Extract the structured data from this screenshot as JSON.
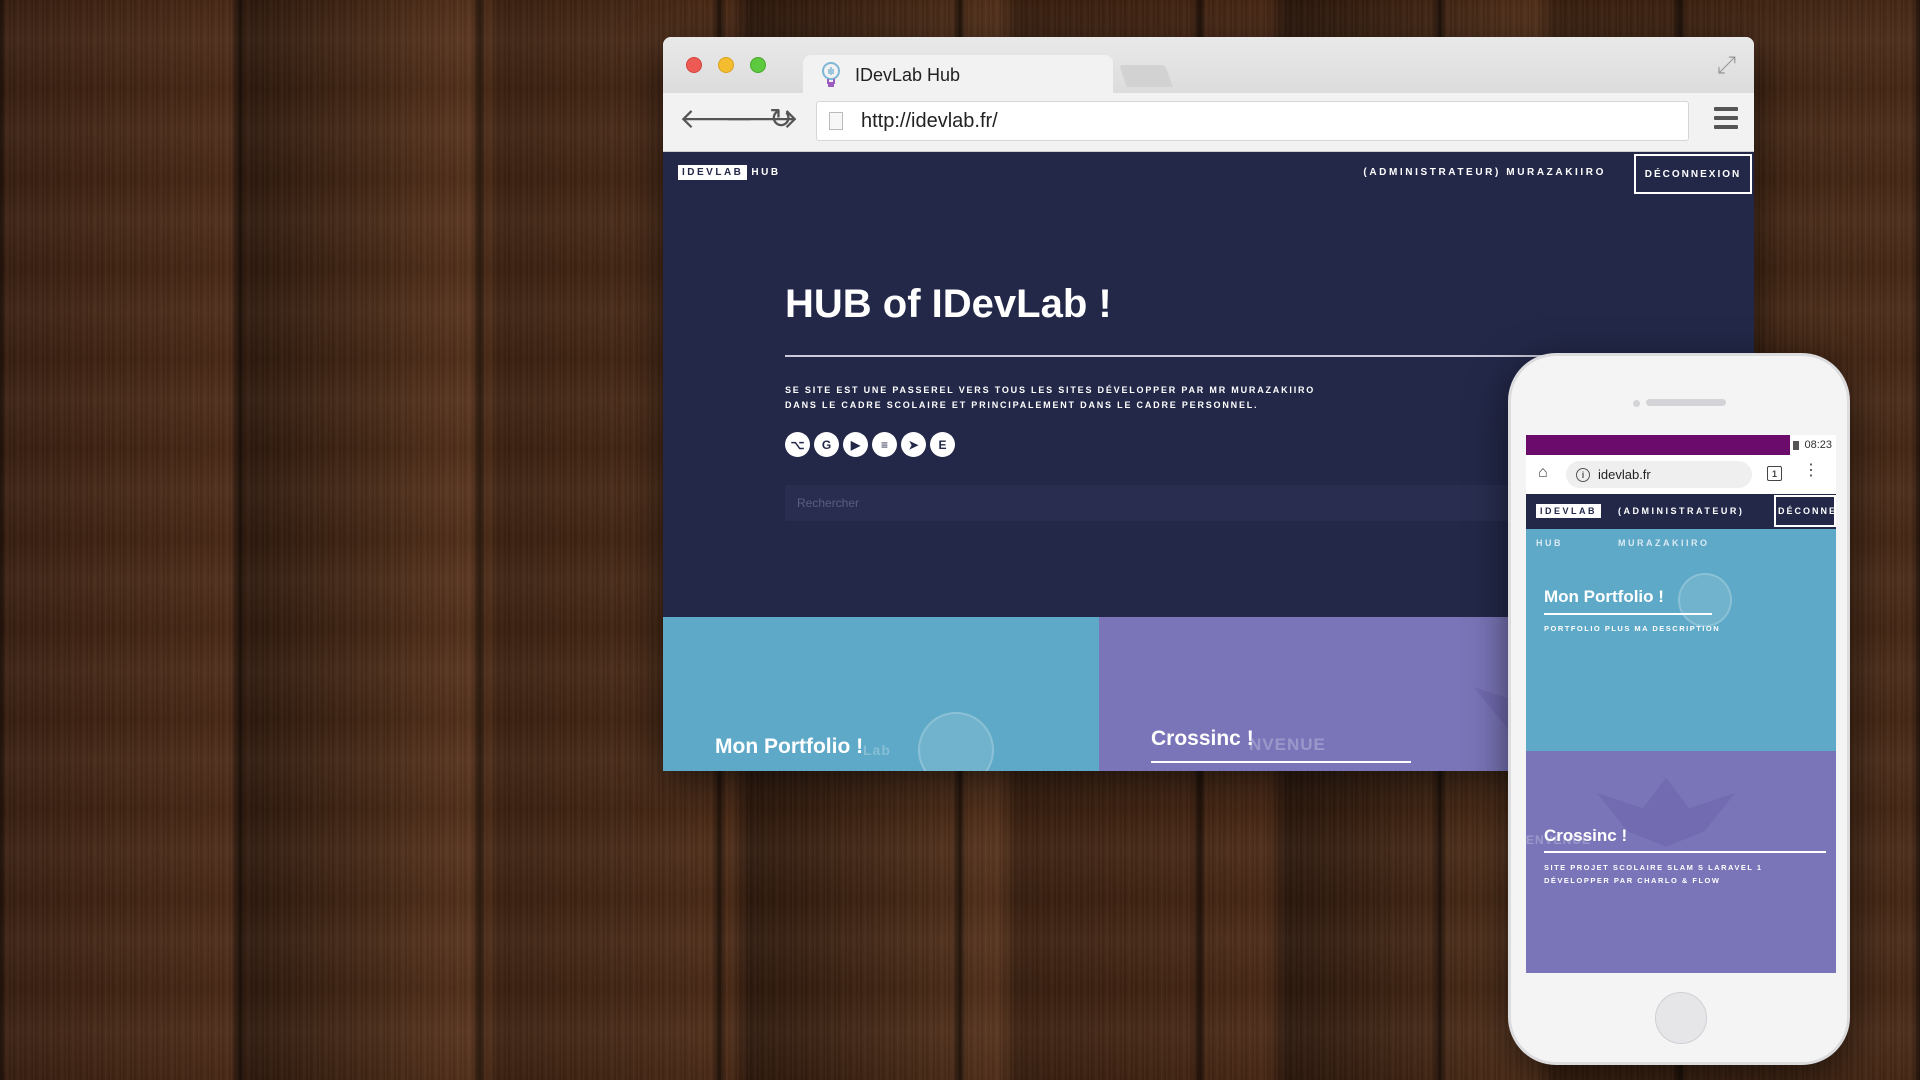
{
  "browser": {
    "tab_title": "IDevLab Hub",
    "url": "http://idevlab.fr/"
  },
  "site": {
    "brand_box": "IDEVLAB",
    "brand_hub": "HUB",
    "user": "(ADMINISTRATEUR) MURAZAKIIRO",
    "logout": "DÉCONNEXION",
    "hero_title": "HUB of IDevLab !",
    "hero_desc_1": "SE SITE EST UNE PASSEREL VERS TOUS LES SITES DÉVELOPPER PAR MR MURAZAKIIRO",
    "hero_desc_2": "DANS LE CADRE SCOLAIRE ET PRINCIPALEMENT DANS LE CADRE PERSONNEL.",
    "social_icons": [
      "github-icon",
      "google-icon",
      "youtube-icon",
      "stack-icon",
      "telegram-icon",
      "etsy-icon"
    ],
    "social_glyphs": [
      "⌥",
      "G",
      "▶",
      "≡",
      "➤",
      "E"
    ],
    "search_placeholder": "Rechercher",
    "cards": [
      {
        "title": "Mon Portfolio !",
        "ghost": "Lab"
      },
      {
        "title": "Crossinc !",
        "ghost": "NVENUE"
      }
    ]
  },
  "phone": {
    "status_time": "08:23",
    "url": "idevlab.fr",
    "tab_count": "1",
    "brand_box": "IDEVLAB",
    "brand_hub": "HUB",
    "user_role": "(ADMINISTRATEUR)",
    "user_name": "MURAZAKIIRO",
    "logout": "DÉCONNEXION",
    "cards": [
      {
        "title": "Mon Portfolio !",
        "desc_1": "PORTFOLIO PLUS MA DESCRIPTION",
        "desc_2": ""
      },
      {
        "title": "Crossinc !",
        "desc_1": "SITE PROJET SCOLAIRE SLAM S LARAVEL 1",
        "desc_2": "DÉVELOPPER PAR CHARLO & FLOW",
        "ghost": "ENVENUE"
      }
    ]
  },
  "colors": {
    "site_bg": "#232849",
    "portfolio_card": "#5ea9c7",
    "crossinc_card": "#7a75b8",
    "status_bar": "#6b0b6b"
  }
}
